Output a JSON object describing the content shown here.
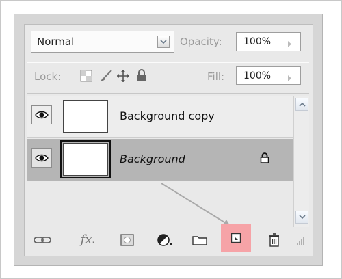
{
  "blend_mode": {
    "value": "Normal"
  },
  "opacity": {
    "label": "Opacity:",
    "value": "100%"
  },
  "lock": {
    "label": "Lock:"
  },
  "fill": {
    "label": "Fill:",
    "value": "100%"
  },
  "layers": [
    {
      "name": "Background copy",
      "visible": true,
      "selected": false,
      "locked": false
    },
    {
      "name": "Background",
      "visible": true,
      "selected": true,
      "locked": true
    }
  ],
  "toolbar": {
    "buttons": [
      "link-layers-icon",
      "fx-icon",
      "layer-mask-icon",
      "adjustment-layer-icon",
      "new-group-icon",
      "new-layer-icon",
      "delete-layer-icon"
    ],
    "fx_label": "fx",
    "highlighted": "new-layer-icon"
  },
  "colors": {
    "highlight": "#f6a3a7",
    "selected_row": "#b5b5b5",
    "panel": "#e9e9e9"
  }
}
